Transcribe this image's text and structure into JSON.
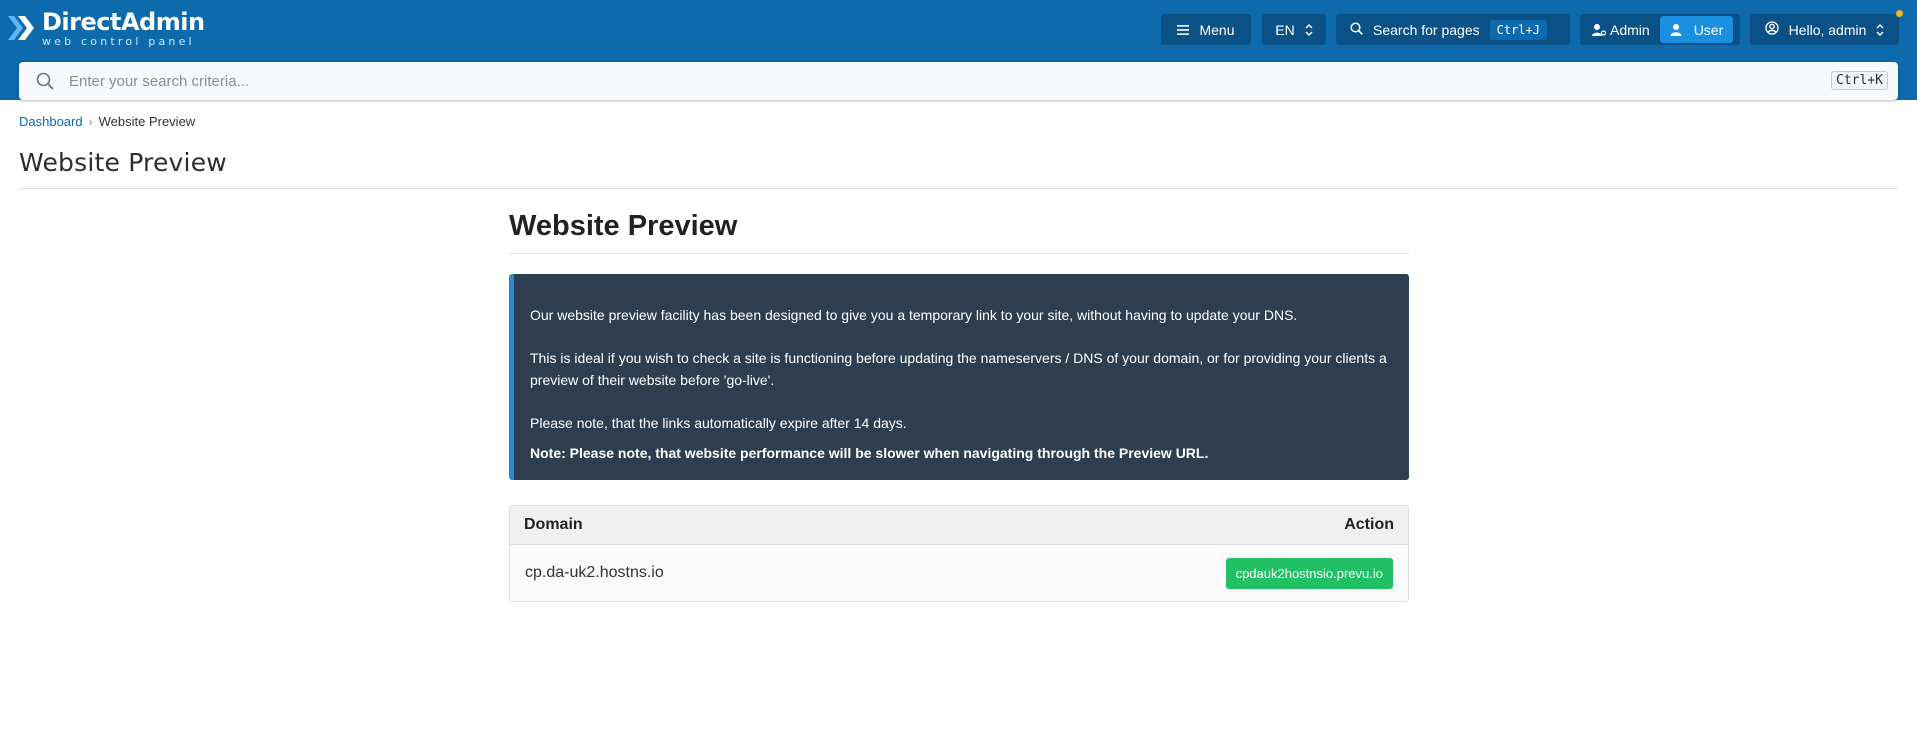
{
  "header": {
    "logo_title": "DirectAdmin",
    "logo_subtitle": "web control panel",
    "menu_label": "Menu",
    "lang_label": "EN",
    "search_label": "Search for pages",
    "search_shortcut": "Ctrl+J",
    "role_admin": "Admin",
    "role_user": "User",
    "greeting": "Hello, admin",
    "accent_color": "#0d6aad",
    "notification_dot_color": "#f2b21d"
  },
  "search": {
    "placeholder": "Enter your search criteria...",
    "shortcut": "Ctrl+K"
  },
  "breadcrumb": {
    "home": "Dashboard",
    "current": "Website Preview"
  },
  "page_title": "Website Preview",
  "content": {
    "heading": "Website Preview",
    "notice": {
      "p1": "Our website preview facility has been designed to give you a temporary link to your site, without having to update your DNS.",
      "p2": "This is ideal if you wish to check a site is functioning before updating the nameservers / DNS of your domain, or for providing your clients a preview of their website before 'go-live'.",
      "p3": "Please note, that the links automatically expire after 14 days.",
      "p4": "Note: Please note, that website performance will be slower when navigating through the Preview URL."
    },
    "table": {
      "col_domain": "Domain",
      "col_action": "Action",
      "rows": [
        {
          "domain": "cp.da-uk2.hostns.io",
          "action": "cpdauk2hostnsio.prevu.io"
        }
      ]
    }
  }
}
